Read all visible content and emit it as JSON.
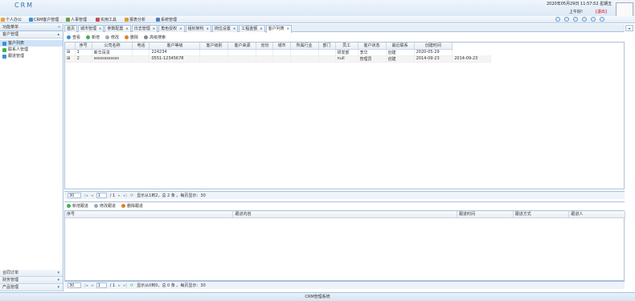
{
  "header": {
    "logo": "CRM",
    "clock": "2020年05月29日 11:57:52 星期五",
    "greeting": "上午好!",
    "logout": "[退出]"
  },
  "menu": [
    {
      "label": "个人办公",
      "color": "#e8a33a"
    },
    {
      "label": "CRM客户管理",
      "color": "#3b8fd6"
    },
    {
      "label": "人事管理",
      "color": "#6b9e3a"
    },
    {
      "label": "实用工具",
      "color": "#c05050"
    },
    {
      "label": "报表分析",
      "color": "#d9a030"
    },
    {
      "label": "系统管理",
      "color": "#4a7fc1"
    }
  ],
  "sidebar": {
    "title": "功能菜单",
    "section": "客户管理",
    "items": [
      {
        "label": "客户列表",
        "selected": true,
        "color": "#3b8fd6"
      },
      {
        "label": "联系人管理",
        "selected": false,
        "color": "#4caf50"
      },
      {
        "label": "跟进管理",
        "selected": false,
        "color": "#3b8fd6"
      }
    ],
    "bottom": [
      "合同订单",
      "财务管理",
      "产品管理"
    ]
  },
  "tabs": [
    "首页",
    "城市管理",
    "参数配置",
    "日志管理",
    "角色授权",
    "组织架构",
    "岗位设置",
    "工程金额",
    "客户列表"
  ],
  "toolbar1": [
    {
      "label": "查看",
      "color": "#3b8fd6"
    },
    {
      "label": "新增",
      "color": "#4caf50"
    },
    {
      "label": "修改",
      "color": "#9ab"
    },
    {
      "label": "删除",
      "color": "#e67e22"
    },
    {
      "label": "高级搜索",
      "color": "#888"
    }
  ],
  "grid1": {
    "columns": [
      "序号",
      "公司名称",
      "电话",
      "客户等级",
      "客户级别",
      "客户来源",
      "省份",
      "城市",
      "所属行业",
      "部门",
      "员工",
      "客户状态",
      "最近联系",
      "创建时间"
    ],
    "rows": [
      [
        "1",
        "新华百货",
        "",
        "224234",
        "",
        "",
        "",
        "",
        "",
        "",
        "研发部",
        "李华",
        "创建",
        "2020-05-29"
      ],
      [
        "2",
        "ssssssssssss",
        "",
        "0551-12345678",
        "",
        "",
        "",
        "",
        "",
        "",
        "null",
        "管理员",
        "创建",
        "2014-09-23",
        "2014-09-23"
      ]
    ]
  },
  "pager1": {
    "size": "30",
    "page": "1",
    "total": "/ 1",
    "info": "显示从1到2，总 2 条 。每页显示：30"
  },
  "toolbar2": [
    {
      "label": "新增跟进",
      "color": "#4caf50"
    },
    {
      "label": "修改跟进",
      "color": "#9ab"
    },
    {
      "label": "删除跟进",
      "color": "#e67e22"
    }
  ],
  "grid2": {
    "columns": [
      "序号",
      "跟进内容",
      "跟进时间",
      "跟进方式",
      "跟进人"
    ]
  },
  "pager2": {
    "size": "30",
    "page": "1",
    "total": "/ 1",
    "info": "显示从0到0，总 0 条 。每页显示：30"
  },
  "footer": "CRM管理系统"
}
